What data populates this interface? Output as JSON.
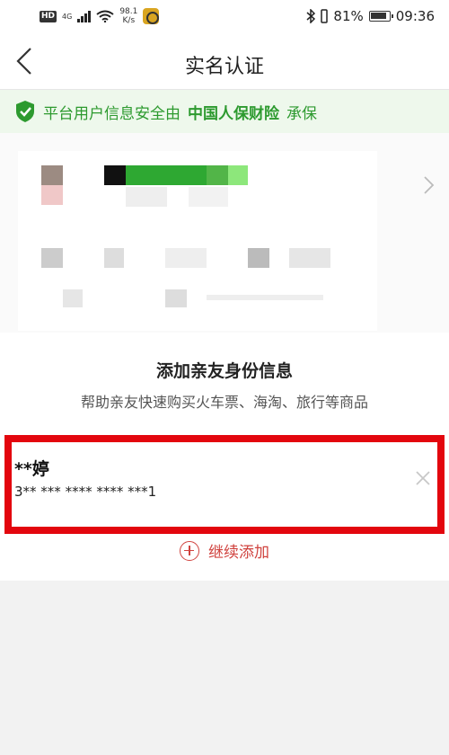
{
  "status_bar": {
    "hd": "HD",
    "network": "4G",
    "speed_value": "98.1",
    "speed_unit": "K/s",
    "battery": "81%",
    "time": "09:36"
  },
  "nav": {
    "title": "实名认证",
    "back_icon": "chevron-left-icon"
  },
  "banner": {
    "icon": "shield-check-icon",
    "text_prefix": "平台用户信息安全由",
    "insurer": "中国人保财险",
    "text_suffix": "承保"
  },
  "family": {
    "title": "添加亲友身份信息",
    "subtitle": "帮助亲友快速购买火车票、海淘、旅行等商品",
    "records": [
      {
        "name": "**婷",
        "id_number": "3** *** **** **** ***1"
      }
    ],
    "add_more_label": "继续添加"
  },
  "colors": {
    "accent_red": "#e3060e",
    "add_red": "#d0433f",
    "banner_green": "#2d9a2f",
    "banner_bg": "#eef8ec"
  }
}
